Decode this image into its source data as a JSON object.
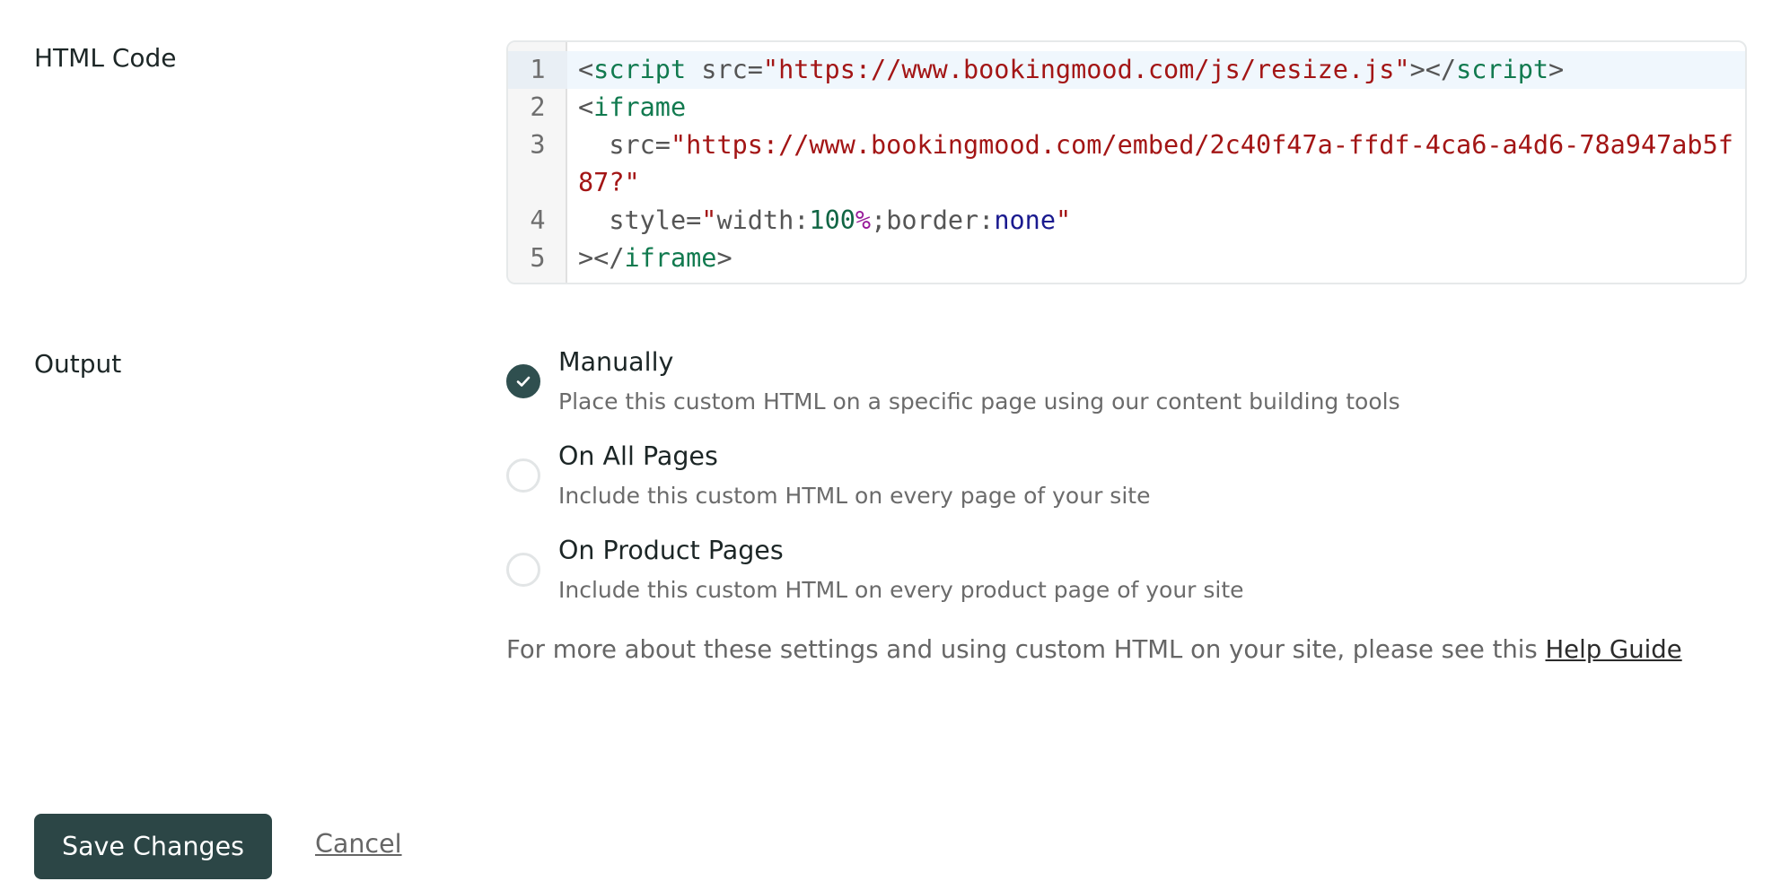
{
  "labels": {
    "html_code": "HTML Code",
    "output": "Output"
  },
  "code_editor": {
    "lines": [
      {
        "number": "1",
        "tokens": [
          {
            "t": "<",
            "c": "punct"
          },
          {
            "t": "script",
            "c": "tag"
          },
          {
            "t": " src=",
            "c": "attr"
          },
          {
            "t": "\"https://www.bookingmood.com/js/resize.js\"",
            "c": "string"
          },
          {
            "t": "></",
            "c": "punct"
          },
          {
            "t": "script",
            "c": "tag"
          },
          {
            "t": ">",
            "c": "punct"
          }
        ]
      },
      {
        "number": "2",
        "tokens": [
          {
            "t": "<",
            "c": "punct"
          },
          {
            "t": "iframe",
            "c": "tag"
          }
        ]
      },
      {
        "number": "3",
        "tokens": [
          {
            "t": "  src=",
            "c": "attr"
          },
          {
            "t": "\"https://www.bookingmood.com/embed/2c40f47a-ffdf-4ca6-a4d6-78a947ab5f87?\"",
            "c": "string"
          }
        ]
      },
      {
        "number": "4",
        "tokens": [
          {
            "t": "  style=",
            "c": "attr"
          },
          {
            "t": "\"",
            "c": "string"
          },
          {
            "t": "width:",
            "c": "attr"
          },
          {
            "t": "100",
            "c": "number"
          },
          {
            "t": "%",
            "c": "unit"
          },
          {
            "t": ";border:",
            "c": "attr"
          },
          {
            "t": "none",
            "c": "keyword"
          },
          {
            "t": "\"",
            "c": "string"
          }
        ]
      },
      {
        "number": "5",
        "tokens": [
          {
            "t": "></",
            "c": "punct"
          },
          {
            "t": "iframe",
            "c": "tag"
          },
          {
            "t": ">",
            "c": "punct"
          }
        ]
      }
    ]
  },
  "output_options": [
    {
      "title": "Manually",
      "description": "Place this custom HTML on a specific page using our content building tools",
      "checked": true
    },
    {
      "title": "On All Pages",
      "description": "Include this custom HTML on every page of your site",
      "checked": false
    },
    {
      "title": "On Product Pages",
      "description": "Include this custom HTML on every product page of your site",
      "checked": false
    }
  ],
  "help": {
    "text": "For more about these settings and using custom HTML on your site, please see this ",
    "link_label": "Help Guide"
  },
  "actions": {
    "save_label": "Save Changes",
    "cancel_label": "Cancel"
  },
  "colors": {
    "primary": "#2c4646",
    "tag": "#117a4f",
    "string": "#a31515",
    "keyword": "#1a1a8f",
    "unit": "#981a9a"
  },
  "icons": {
    "checked_radio": "check-icon"
  }
}
